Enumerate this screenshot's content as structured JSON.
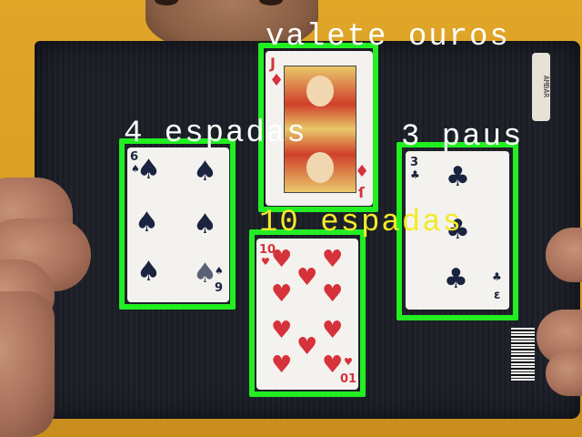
{
  "labels": {
    "jack": "valete ouros",
    "four": "4 espadas",
    "three": "3 paus",
    "ten": "10 espadas"
  },
  "cards": {
    "six_spades_rank": "6",
    "six_spades_rank_bottom": "9",
    "jack_rank": "J",
    "jack_rank_bottom": "ſ",
    "three_clubs_rank": "3",
    "three_clubs_rank_bottom": "ε",
    "ten_hearts_rank": "10",
    "ten_hearts_rank_bottom": "01"
  },
  "book": {
    "brand": "AMBAR"
  },
  "colors": {
    "box": "#22ee22",
    "label_white": "#ffffff",
    "label_yellow": "#f2ea2a"
  }
}
